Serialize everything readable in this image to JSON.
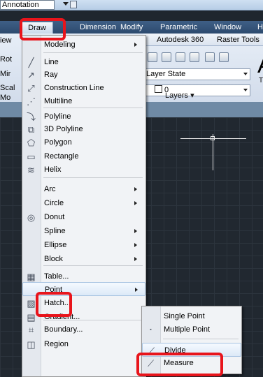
{
  "workspace": {
    "value": "Annotation"
  },
  "ribbon_tabs": [
    {
      "label": "Draw"
    },
    {
      "label": "Dimension"
    },
    {
      "label": "Modify"
    },
    {
      "label": "Parametric"
    },
    {
      "label": "Window"
    },
    {
      "label": "H"
    }
  ],
  "ribbon_partial_left": [
    "iew",
    "Rot",
    "Mir",
    "Scal",
    "Mo"
  ],
  "ribbon_subtabs": [
    {
      "label": "Autodesk 360"
    },
    {
      "label": "Raster Tools"
    }
  ],
  "layers_panel": {
    "layer_state_value": "Layer State",
    "layer_value": "0",
    "title": "Layers",
    "side_text_big": "A",
    "side_text_small": "T"
  },
  "draw_menu": [
    {
      "label": "Modeling",
      "icon": "",
      "submenu": true
    },
    {
      "label": "Line",
      "icon": "line-icon",
      "glyph": "╱"
    },
    {
      "label": "Ray",
      "icon": "ray-icon",
      "glyph": "↗"
    },
    {
      "label": "Construction Line",
      "icon": "construction-line-icon",
      "glyph": "⤢"
    },
    {
      "label": "Multiline",
      "icon": "multiline-icon",
      "glyph": "⋰"
    },
    {
      "label": "Polyline",
      "icon": "polyline-icon",
      "glyph": "⤵"
    },
    {
      "label": "3D Polyline",
      "icon": "3d-polyline-icon",
      "glyph": "⧉"
    },
    {
      "label": "Polygon",
      "icon": "polygon-icon",
      "glyph": "⬠"
    },
    {
      "label": "Rectangle",
      "icon": "rectangle-icon",
      "glyph": "▭"
    },
    {
      "label": "Helix",
      "icon": "helix-icon",
      "glyph": "≋"
    },
    {
      "label": "Arc",
      "submenu": true
    },
    {
      "label": "Circle",
      "submenu": true
    },
    {
      "label": "Donut",
      "icon": "donut-icon",
      "glyph": "◎"
    },
    {
      "label": "Spline",
      "submenu": true
    },
    {
      "label": "Ellipse",
      "submenu": true
    },
    {
      "label": "Block",
      "submenu": true
    },
    {
      "label": "Table...",
      "icon": "table-icon",
      "glyph": "▦"
    },
    {
      "label": "Point",
      "submenu": true,
      "highlighted": true
    },
    {
      "label": "Hatch...",
      "icon": "hatch-icon",
      "glyph": "▨"
    },
    {
      "label": "Gradient...",
      "icon": "gradient-icon",
      "glyph": "▤"
    },
    {
      "label": "Boundary...",
      "icon": "boundary-icon",
      "glyph": "⌗"
    },
    {
      "label": "Region",
      "icon": "region-icon",
      "glyph": "◫"
    }
  ],
  "point_submenu": [
    {
      "label": "Single Point",
      "icon": ""
    },
    {
      "label": "Multiple Point",
      "icon": "multiple-point-icon",
      "glyph": "▪"
    },
    {
      "label": "Divide",
      "icon": "divide-icon",
      "glyph": "⟋",
      "highlighted": true
    },
    {
      "label": "Measure",
      "icon": "measure-icon",
      "glyph": "⟋"
    }
  ],
  "colors": {
    "annotation_red": "#e8141b",
    "highlight": "#dce9f7",
    "ribbon_blue": "#2d4a6e",
    "canvas": "#212830"
  }
}
